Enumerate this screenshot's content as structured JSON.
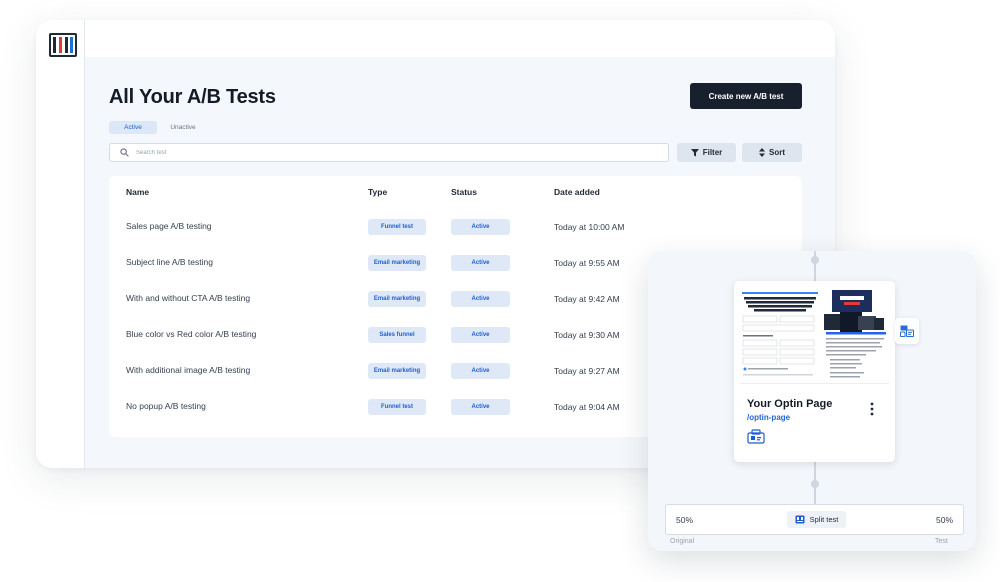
{
  "app": {
    "logo": "clickfunnels-logo-icon"
  },
  "page": {
    "title": "All Your A/B Tests",
    "create_button": "Create new A/B test"
  },
  "tabs": [
    {
      "label": "Active",
      "active": true
    },
    {
      "label": "Unactive",
      "active": false
    }
  ],
  "search": {
    "placeholder": "Search test",
    "value": ""
  },
  "toolbar": {
    "filter_label": "Filter",
    "sort_label": "Sort"
  },
  "table": {
    "columns": [
      "Name",
      "Type",
      "Status",
      "Date added"
    ],
    "rows": [
      {
        "name": "Sales page A/B testing",
        "type": "Funnel test",
        "status": "Active",
        "date": "Today at 10:00 AM"
      },
      {
        "name": "Subject line A/B testing",
        "type": "Email marketing",
        "status": "Active",
        "date": "Today at 9:55 AM"
      },
      {
        "name": "With and without CTA A/B testing",
        "type": "Email marketing",
        "status": "Active",
        "date": "Today at 9:42 AM"
      },
      {
        "name": "Blue color vs Red color A/B testing",
        "type": "Sales funnel",
        "status": "Active",
        "date": "Today at 9:30 AM"
      },
      {
        "name": "With additional image A/B testing",
        "type": "Email marketing",
        "status": "Active",
        "date": "Today at 9:27 AM"
      },
      {
        "name": "No popup A/B testing",
        "type": "Funnel test",
        "status": "Active",
        "date": "Today at 9:04 AM"
      }
    ]
  },
  "optin_card": {
    "title": "Your Optin Page",
    "path": "/optin-page",
    "thumbnail_headline": "Start Your 30-Day FREE Trial Today And Get The 'Your First Funnel' VIP Experience ($1,997 Value) For FREE"
  },
  "split": {
    "left_percent": "50%",
    "right_percent": "50%",
    "label": "Split test",
    "left_caption": "Original",
    "right_caption": "Test"
  },
  "colors": {
    "accent": "#1f5fd4",
    "badge_bg": "#dfe8f6",
    "primary_button": "#17202c",
    "canvas_bg": "#f4f7fb"
  }
}
